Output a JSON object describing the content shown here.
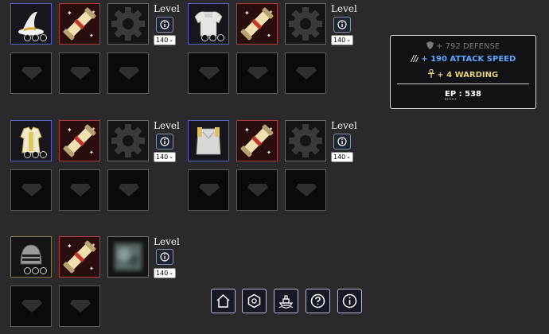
{
  "level_label": "Level",
  "equipment_sets": [
    {
      "items": [
        {
          "name": "wizard hat",
          "icon": "wizard-hat-icon"
        },
        {
          "name": "scroll",
          "icon": "scroll-icon"
        },
        {
          "name": "empty mod slot",
          "icon": "gear-icon"
        }
      ],
      "level": "140"
    },
    {
      "items": [
        {
          "name": "white armor",
          "icon": "armor-icon"
        },
        {
          "name": "scroll",
          "icon": "scroll-icon"
        },
        {
          "name": "empty mod slot",
          "icon": "gear-icon"
        }
      ],
      "level": "140"
    },
    {
      "items": [
        {
          "name": "white robe",
          "icon": "robe-icon"
        },
        {
          "name": "scroll",
          "icon": "scroll-icon"
        },
        {
          "name": "empty mod slot",
          "icon": "gear-icon"
        }
      ],
      "level": "140"
    },
    {
      "items": [
        {
          "name": "white cloak",
          "icon": "cloak-icon"
        },
        {
          "name": "scroll",
          "icon": "scroll-icon"
        },
        {
          "name": "empty mod slot",
          "icon": "gear-icon"
        }
      ],
      "level": "140"
    },
    {
      "items": [
        {
          "name": "knight helmet",
          "icon": "helmet-icon"
        },
        {
          "name": "scroll",
          "icon": "scroll-icon"
        },
        {
          "name": "blurred item",
          "icon": "blurred-item-icon"
        }
      ],
      "level": "140"
    }
  ],
  "stats": {
    "defense": "+ 792 DEFENSE",
    "attack_speed": "+ 190 ATTACK SPEED",
    "warding": "+ 4 WARDING",
    "ep_label": "EP",
    "ep_value": ": 538",
    "colors": {
      "defense": "#7a7a7a",
      "attack_speed": "#5aa8ff",
      "warding": "#e6d07a"
    }
  },
  "nav": [
    {
      "name": "home-button",
      "icon": "home-icon"
    },
    {
      "name": "hexagon-button",
      "icon": "hexagon-icon"
    },
    {
      "name": "ship-button",
      "icon": "ship-icon"
    },
    {
      "name": "help-button",
      "icon": "question-icon"
    },
    {
      "name": "info-button",
      "icon": "info-icon"
    }
  ]
}
